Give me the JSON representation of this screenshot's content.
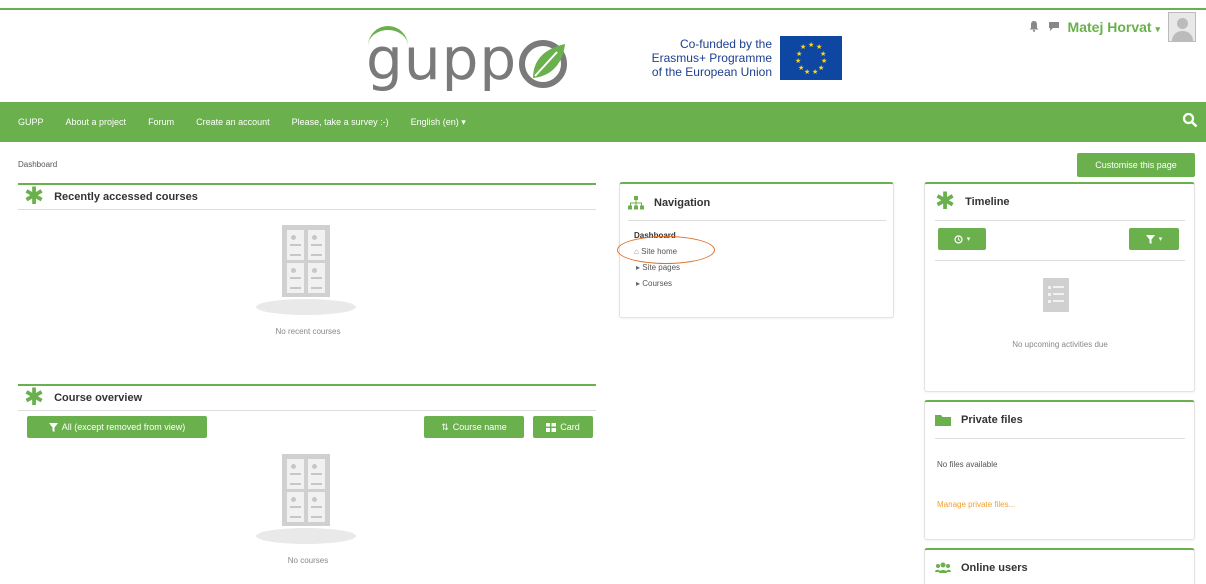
{
  "brand": {
    "logo_text": "gupp",
    "erasmus_text": "Co-funded by the Erasmus+ Programme of the European Union",
    "accent": "#6ab04c",
    "highlight": "#e0702a"
  },
  "user": {
    "name": "Matej Horvat",
    "caret": "▾"
  },
  "navbar": {
    "items": [
      "GUPP",
      "About a project",
      "Forum",
      "Create an account",
      "Please, take a survey :-)",
      "English (en) ▾"
    ]
  },
  "breadcrumb": "Dashboard",
  "customise_label": "Customise this page",
  "recent": {
    "title": "Recently accessed courses",
    "empty": "No recent courses"
  },
  "overview": {
    "title": "Course overview",
    "filter_label": "All (except removed from view)",
    "sort_label": "Course name",
    "view_label": "Card",
    "empty": "No courses"
  },
  "navigation": {
    "title": "Navigation",
    "items": [
      "Dashboard",
      "Site home",
      "Site pages",
      "Courses"
    ]
  },
  "timeline": {
    "title": "Timeline",
    "empty": "No upcoming activities due"
  },
  "private_files": {
    "title": "Private files",
    "empty": "No files available",
    "manage": "Manage private files..."
  },
  "online_users": {
    "title": "Online users"
  }
}
